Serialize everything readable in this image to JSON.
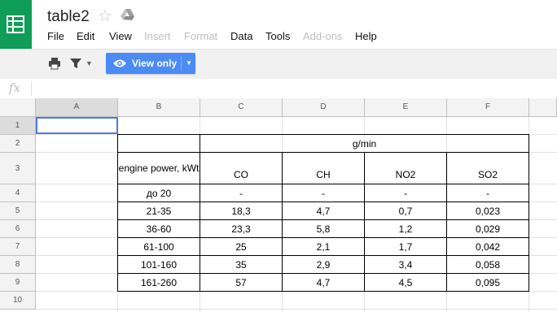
{
  "doc": {
    "title": "table2",
    "star_icon": "☆"
  },
  "menu": {
    "items": [
      {
        "label": "File",
        "disabled": false
      },
      {
        "label": "Edit",
        "disabled": false
      },
      {
        "label": "View",
        "disabled": false
      },
      {
        "label": "Insert",
        "disabled": true
      },
      {
        "label": "Format",
        "disabled": true
      },
      {
        "label": "Data",
        "disabled": false
      },
      {
        "label": "Tools",
        "disabled": false
      },
      {
        "label": "Add-ons",
        "disabled": true
      },
      {
        "label": "Help",
        "disabled": false
      }
    ]
  },
  "toolbar": {
    "view_only_label": "View only",
    "view_only_color": "#4a8bf5"
  },
  "formula_bar": {
    "fx_label": "fx",
    "value": ""
  },
  "grid": {
    "columns": [
      "A",
      "B",
      "C",
      "D",
      "E",
      "F"
    ],
    "rows": [
      "1",
      "2",
      "3",
      "4",
      "5",
      "6",
      "7",
      "8",
      "9",
      "10"
    ],
    "selected_cell": "A1"
  },
  "table": {
    "group_header": "g/min",
    "header_engine": "engine power, kWt",
    "headers": [
      "CO",
      "CH",
      "NO2",
      "SO2"
    ],
    "rows": [
      {
        "power": "до 20",
        "values": [
          "-",
          "-",
          "-",
          "-"
        ]
      },
      {
        "power": "21-35",
        "values": [
          "18,3",
          "4,7",
          "0,7",
          "0,023"
        ]
      },
      {
        "power": "36-60",
        "values": [
          "23,3",
          "5,8",
          "1,2",
          "0,029"
        ]
      },
      {
        "power": "61-100",
        "values": [
          "25",
          "2,1",
          "1,7",
          "0,042"
        ]
      },
      {
        "power": "101-160",
        "values": [
          "35",
          "2,9",
          "3,4",
          "0,058"
        ]
      },
      {
        "power": "161-260",
        "values": [
          "57",
          "4,7",
          "4,5",
          "0,095"
        ]
      }
    ]
  },
  "colors": {
    "brand_green": "#0f9d58",
    "selection_blue": "#4d7ee0"
  }
}
